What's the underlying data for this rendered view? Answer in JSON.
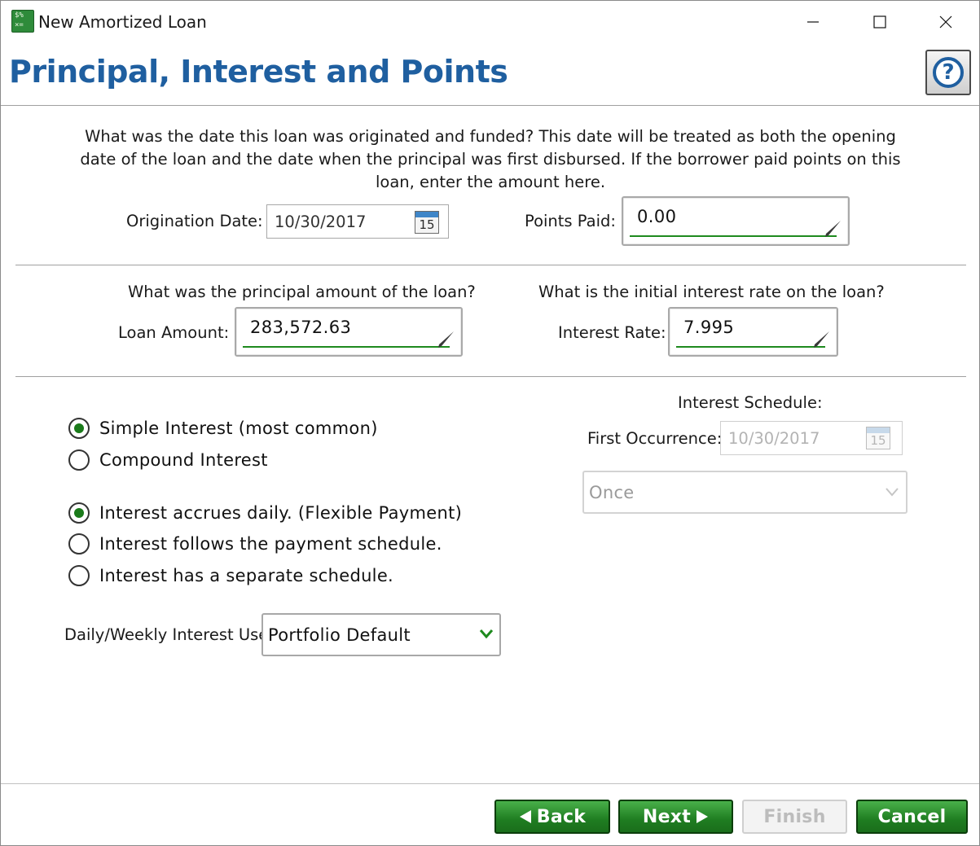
{
  "window": {
    "title": "New Amortized Loan",
    "minimize_icon": "minimize-icon",
    "maximize_icon": "maximize-icon",
    "close_icon": "close-icon"
  },
  "header": {
    "title": "Principal, Interest and Points",
    "help_label": "?"
  },
  "origination": {
    "description": "What was the date this loan was originated and funded? This date will be treated as both the opening date of the loan and the date when the principal was first disbursed.  If the borrower paid points on this loan, enter the amount here.",
    "date_label": "Origination Date:",
    "date_value": "10/30/2017",
    "calendar_day": "15",
    "points_label": "Points Paid:",
    "points_value": "0.00"
  },
  "principal": {
    "question": "What was the principal amount of the loan?",
    "label": "Loan Amount:",
    "value": "283,572.63"
  },
  "rate": {
    "question": "What is the initial interest rate on the loan?",
    "label": "Interest Rate:",
    "value": "7.995"
  },
  "interest_type": {
    "options": [
      {
        "label": "Simple Interest (most common)",
        "selected": true
      },
      {
        "label": "Compound Interest",
        "selected": false
      }
    ]
  },
  "accrual": {
    "options": [
      {
        "label": "Interest accrues daily. (Flexible Payment)",
        "selected": true
      },
      {
        "label": "Interest follows the payment schedule.",
        "selected": false
      },
      {
        "label": "Interest has a separate schedule.",
        "selected": false
      }
    ]
  },
  "daily_weekly": {
    "label": "Daily/Weekly Interest Use:",
    "value": "Portfolio Default"
  },
  "schedule": {
    "title": "Interest Schedule:",
    "first_label": "First Occurrence:",
    "first_value": "10/30/2017",
    "calendar_day": "15",
    "frequency_value": "Once"
  },
  "footer": {
    "back_label": "Back",
    "next_label": "Next",
    "finish_label": "Finish",
    "cancel_label": "Cancel"
  },
  "colors": {
    "title_blue": "#1f5fa0",
    "accent_green": "#1e8a1e",
    "button_green": "#1f7d21"
  }
}
